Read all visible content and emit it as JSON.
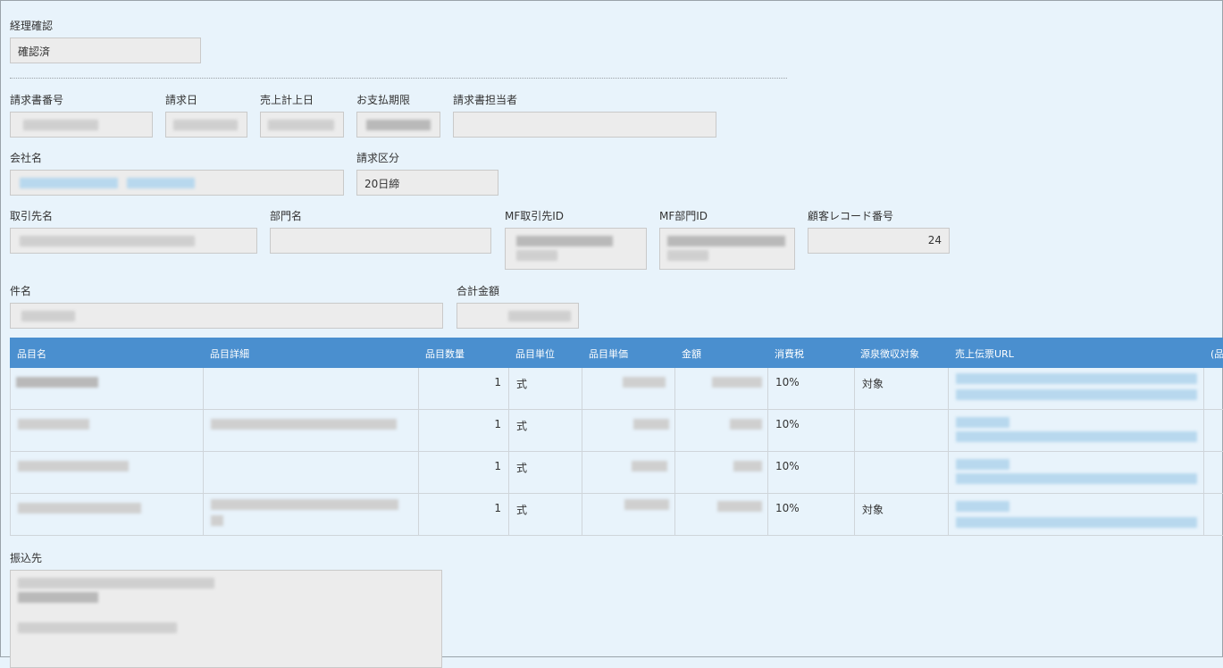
{
  "approval": {
    "label": "経理確認",
    "value": "確認済"
  },
  "invoice": {
    "number_label": "請求書番号",
    "date_label": "請求日",
    "sales_date_label": "売上計上日",
    "due_label": "お支払期限",
    "owner_label": "請求書担当者"
  },
  "company": {
    "label": "会社名",
    "billing_label": "請求区分",
    "billing_value": "20日締"
  },
  "client": {
    "name_label": "取引先名",
    "dept_label": "部門名",
    "mf_client_label": "MF取引先ID",
    "mf_dept_label": "MF部門ID",
    "record_label": "顧客レコード番号",
    "record_value": "24"
  },
  "subject": {
    "label": "件名",
    "total_label": "合計金額"
  },
  "table": {
    "headers": [
      "品目名",
      "品目詳細",
      "品目数量",
      "品目単位",
      "品目単価",
      "金額",
      "消費税",
      "源泉徴収対象",
      "売上伝票URL",
      "(品"
    ],
    "rows": [
      {
        "qty": "1",
        "unit": "式",
        "tax": "10%",
        "withholding": "対象"
      },
      {
        "qty": "1",
        "unit": "式",
        "tax": "10%",
        "withholding": ""
      },
      {
        "qty": "1",
        "unit": "式",
        "tax": "10%",
        "withholding": ""
      },
      {
        "qty": "1",
        "unit": "式",
        "tax": "10%",
        "withholding": "対象"
      }
    ]
  },
  "bank": {
    "label": "振込先"
  }
}
